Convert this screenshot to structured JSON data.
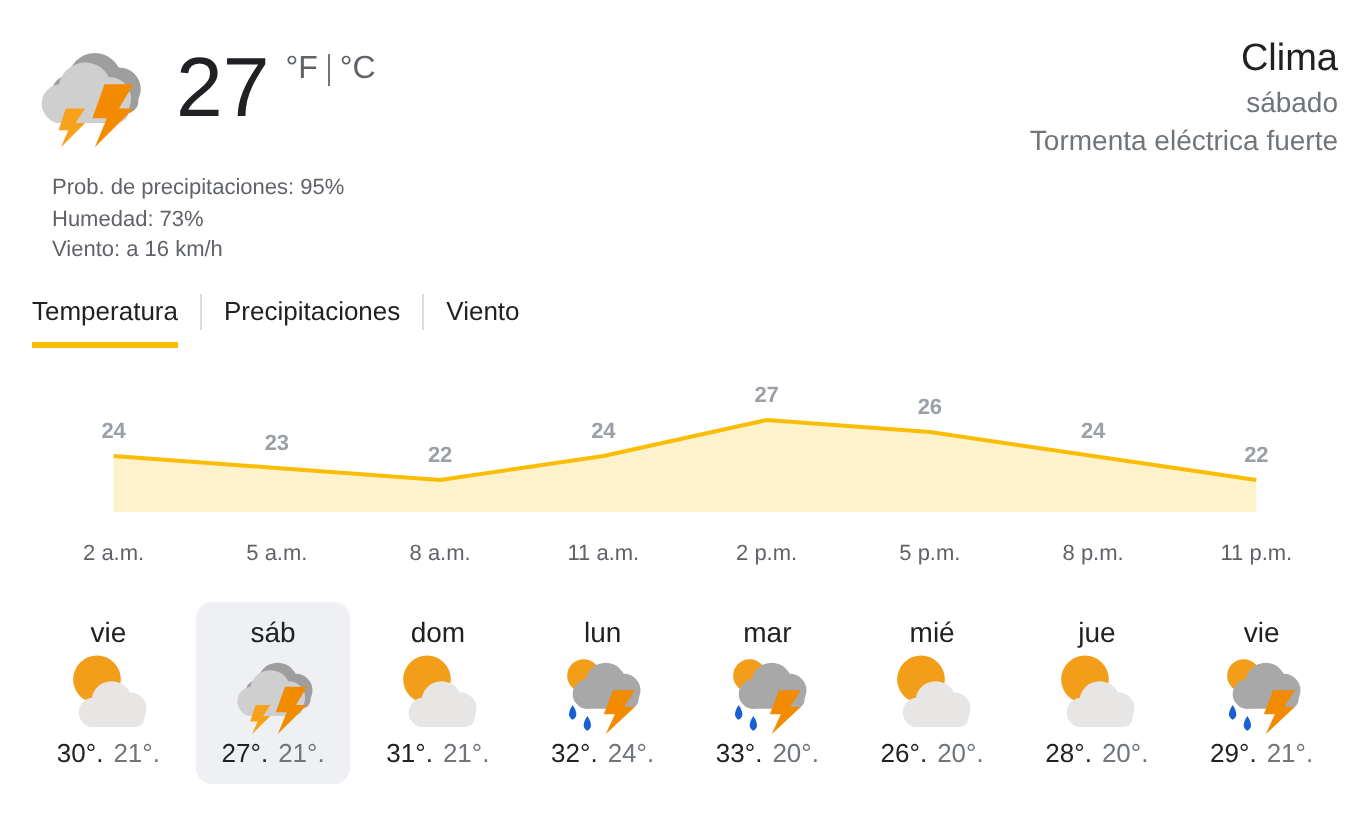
{
  "current": {
    "kind": "storm",
    "temperature": "27",
    "units": [
      "°F",
      "°C"
    ],
    "details": [
      "Prob. de precipitaciones: 95%",
      "Humedad: 73%",
      "Viento: a 16 km/h"
    ]
  },
  "location": {
    "title": "Clima",
    "day": "sábado",
    "condition": "Tormenta eléctrica fuerte"
  },
  "tabs": [
    {
      "label": "Temperatura",
      "selected": true
    },
    {
      "label": "Precipitaciones",
      "selected": false
    },
    {
      "label": "Viento",
      "selected": false
    }
  ],
  "chart": {
    "chart_data": {
      "type": "area",
      "categories": [
        "2 a.m.",
        "5 a.m.",
        "8 a.m.",
        "11 a.m.",
        "2 p.m.",
        "5 p.m.",
        "8 p.m.",
        "11 p.m."
      ],
      "series": [
        {
          "color": "#fbbc04",
          "values": [
            24,
            23,
            22,
            24,
            27,
            26,
            24,
            22
          ]
        }
      ],
      "data_labels": true
    }
  },
  "days": [
    {
      "day": "vie",
      "kind": "partly-cloudy",
      "high": "30°.",
      "low": "21°.",
      "selected": false
    },
    {
      "day": "sáb",
      "kind": "storm",
      "high": "27°.",
      "low": "21°.",
      "selected": true
    },
    {
      "day": "dom",
      "kind": "partly-cloudy",
      "high": "31°.",
      "low": "21°.",
      "selected": false
    },
    {
      "day": "lun",
      "kind": "rain-storm",
      "high": "32°.",
      "low": "24°.",
      "selected": false
    },
    {
      "day": "mar",
      "kind": "rain-storm",
      "high": "33°.",
      "low": "20°.",
      "selected": false
    },
    {
      "day": "mié",
      "kind": "partly-cloudy",
      "high": "26°.",
      "low": "20°.",
      "selected": false
    },
    {
      "day": "jue",
      "kind": "partly-cloudy",
      "high": "28°.",
      "low": "20°.",
      "selected": false
    },
    {
      "day": "vie",
      "kind": "rain-storm",
      "high": "29°.",
      "low": "21°.",
      "selected": false
    }
  ]
}
